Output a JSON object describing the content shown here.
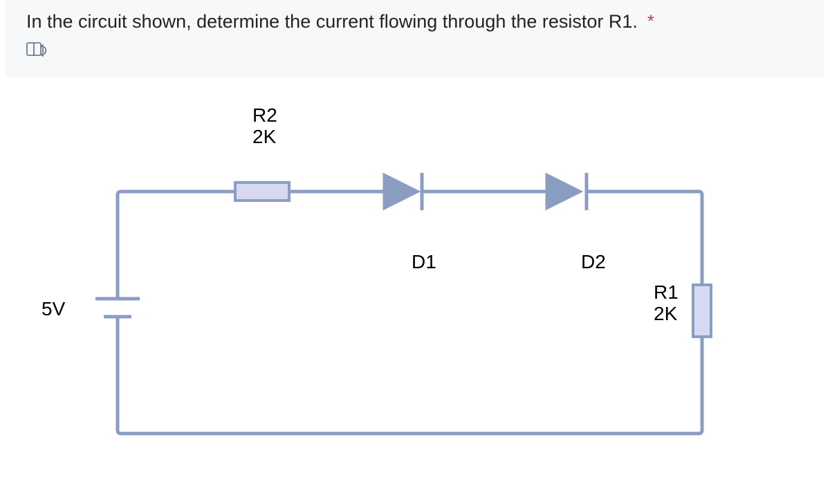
{
  "question": {
    "text": "In the circuit shown, determine the current flowing through the resistor R1.",
    "required_marker": "*",
    "has_image_toggle": true
  },
  "circuit": {
    "source": {
      "label": "5V",
      "voltage_v": 5
    },
    "R2": {
      "label": "R2",
      "value_label": "2K",
      "ohms": 2000
    },
    "R1": {
      "label": "R1",
      "value_label": "2K",
      "ohms": 2000
    },
    "D1": {
      "label": "D1",
      "type": "diode",
      "direction": "forward"
    },
    "D2": {
      "label": "D2",
      "type": "diode",
      "direction": "forward"
    }
  },
  "colors": {
    "wire": "#8b9dc3",
    "resistor_fill": "#d7d9f2",
    "question_bg": "#f7f8f9",
    "text": "#232324",
    "required": "#c4314b"
  }
}
